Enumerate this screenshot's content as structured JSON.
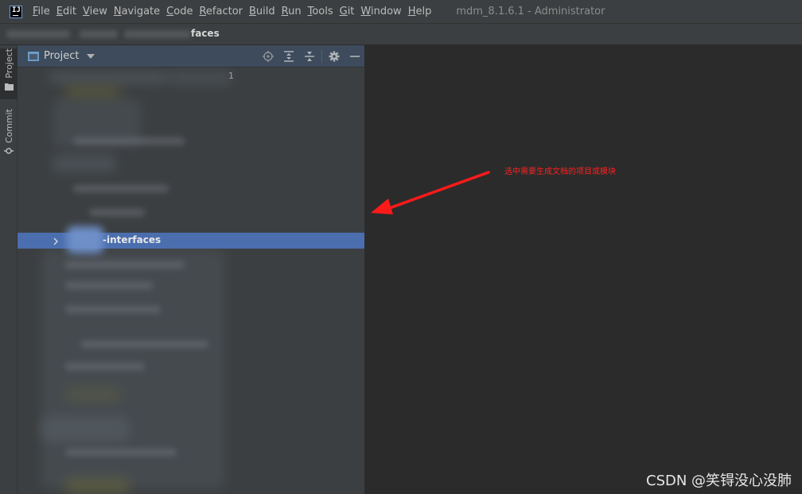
{
  "app": {
    "logo_text": "IJ",
    "window_title": "mdm_8.1.6.1 - Administrator"
  },
  "menu": [
    {
      "first": "F",
      "rest": "ile"
    },
    {
      "first": "E",
      "rest": "dit"
    },
    {
      "first": "V",
      "rest": "iew"
    },
    {
      "first": "N",
      "rest": "avigate"
    },
    {
      "first": "C",
      "rest": "ode"
    },
    {
      "first": "R",
      "rest": "efactor"
    },
    {
      "first": "B",
      "rest": "uild"
    },
    {
      "first": "R",
      "rest": "un"
    },
    {
      "first": "T",
      "rest": "ools"
    },
    {
      "first": "G",
      "rest": "it"
    },
    {
      "first": "W",
      "rest": "indow"
    },
    {
      "first": "H",
      "rest": "elp"
    }
  ],
  "breadcrumb": {
    "visible_text": "faces"
  },
  "tool_stripe": {
    "project_label": "Project",
    "commit_label": "Commit"
  },
  "project_panel": {
    "title": "Project",
    "header_icons": [
      "locate-icon",
      "expand-all-icon",
      "collapse-all-icon",
      "gear-icon",
      "minimize-icon"
    ],
    "line_number": "1",
    "selected_row_label": "-interfaces"
  },
  "annotation": {
    "text": "选中需要生成文档的项目或模块",
    "color": "#ff2020"
  },
  "watermark": "CSDN @笑锝没心没肺",
  "colors": {
    "selection": "#4b6eaf",
    "panel_bg": "#3c3f41",
    "editor_bg": "#2b2b2b",
    "arrow": "#ff1a1a"
  }
}
